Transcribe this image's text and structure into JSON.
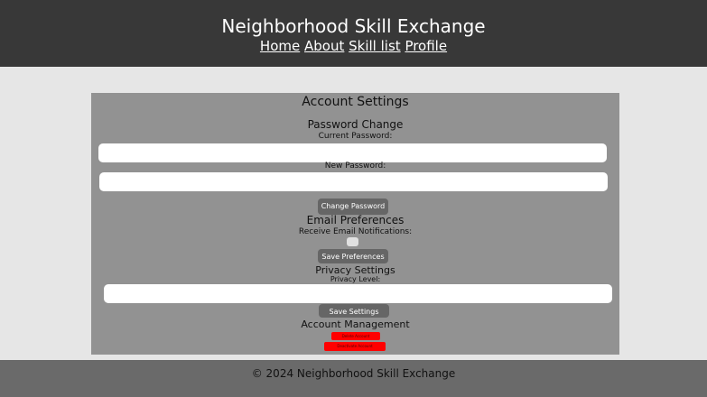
{
  "header": {
    "title": "Neighborhood Skill Exchange",
    "nav": [
      "Home",
      "About",
      "Skill list",
      "Profile"
    ]
  },
  "settings": {
    "title": "Account Settings",
    "password": {
      "heading": "Password Change",
      "current_label": "Current Password:",
      "current_value": "",
      "new_label": "New Password:",
      "new_value": "",
      "button": "Change Password"
    },
    "email": {
      "heading": "Email Preferences",
      "notifications_label": "Receive Email Notifications:",
      "notifications_checked": false,
      "button": "Save Preferences"
    },
    "privacy": {
      "heading": "Privacy Settings",
      "level_label": "Privacy Level:",
      "level_value": "",
      "button": "Save Settings"
    },
    "account": {
      "heading": "Account Management",
      "delete_button": "Delete Account",
      "deactivate_button": "Deactivate Account"
    }
  },
  "footer": {
    "text": "© 2024 Neighborhood Skill Exchange"
  },
  "colors": {
    "header_bg": "#383838",
    "page_bg": "#e6e6e6",
    "panel_bg": "#929292",
    "button_bg": "#666666",
    "danger": "#ff0000",
    "footer_bg": "#6a6a6a"
  }
}
